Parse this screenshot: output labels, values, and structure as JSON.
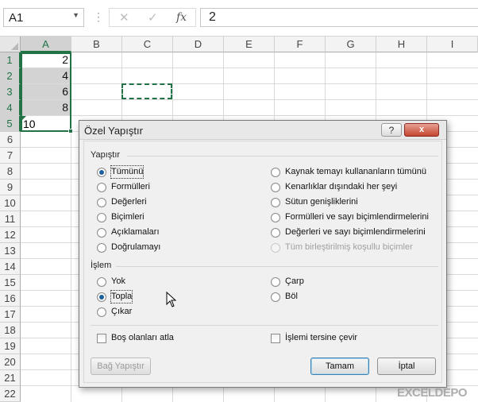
{
  "formula_bar": {
    "name_box": "A1",
    "separator": "⋮",
    "cancel_icon": "✕",
    "enter_icon": "✓",
    "fx_label": "fx",
    "formula_value": "2"
  },
  "columns": [
    "A",
    "B",
    "C",
    "D",
    "E",
    "F",
    "G",
    "H",
    "I"
  ],
  "rows": [
    "1",
    "2",
    "3",
    "4",
    "5",
    "6",
    "7",
    "8",
    "9",
    "10",
    "11",
    "12",
    "13",
    "14",
    "15",
    "16",
    "17",
    "18",
    "19",
    "20",
    "21",
    "22"
  ],
  "cells": {
    "A1": "2",
    "A2": "4",
    "A3": "6",
    "A4": "8",
    "A5": "10"
  },
  "colors": {
    "accent": "#217346",
    "selection_fill": "#d3d3d3",
    "dialog_bg": "#f0f0f0"
  },
  "dialog": {
    "title": "Özel Yapıştır",
    "help_label": "?",
    "close_label": "x",
    "paste_group": "Yapıştır",
    "paste_left": [
      "Tümünü",
      "Formülleri",
      "Değerleri",
      "Biçimleri",
      "Açıklamaları",
      "Doğrulamayı"
    ],
    "paste_right": [
      "Kaynak temayı kullananların tümünü",
      "Kenarlıklar dışındaki her şeyi",
      "Sütun genişliklerini",
      "Formülleri ve sayı biçimlendirmelerini",
      "Değerleri ve sayı biçimlendirmelerini",
      "Tüm birleştirilmiş koşullu biçimler"
    ],
    "paste_selected": "Tümünü",
    "operation_group": "İşlem",
    "operation_left": [
      "Yok",
      "Topla",
      "Çıkar"
    ],
    "operation_right": [
      "Çarp",
      "Böl"
    ],
    "operation_selected": "Topla",
    "skip_blanks": "Boş olanları atla",
    "transpose": "İşlemi tersine çevir",
    "paste_link_button": "Bağ Yapıştır",
    "ok_button": "Tamam",
    "cancel_button": "İptal"
  },
  "watermark": "EXCELDEPO"
}
